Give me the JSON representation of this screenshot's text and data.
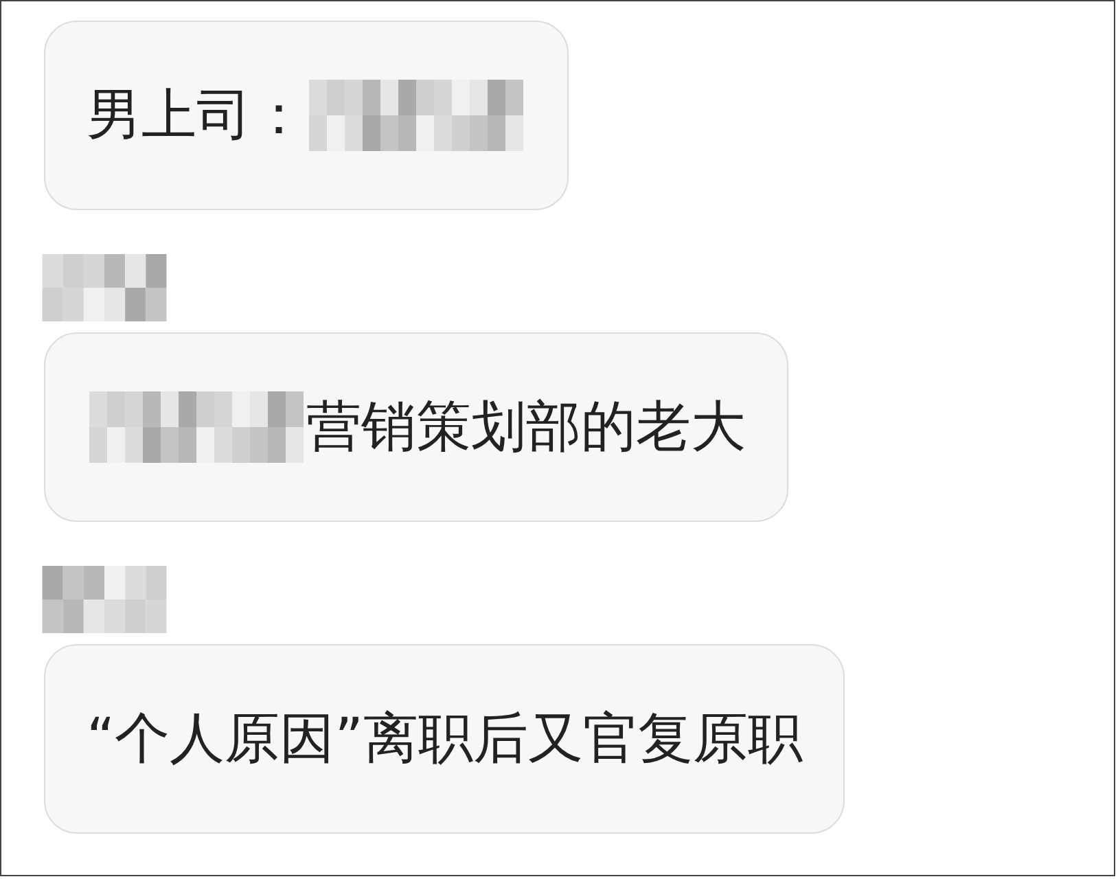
{
  "messages": [
    {
      "sender_redacted": false,
      "parts": [
        {
          "kind": "text",
          "text": "男上司："
        },
        {
          "kind": "redacted"
        }
      ]
    },
    {
      "sender_redacted": true,
      "parts": [
        {
          "kind": "redacted"
        },
        {
          "kind": "text",
          "text": "营销策划部的老大"
        }
      ]
    },
    {
      "sender_redacted": true,
      "parts": [
        {
          "kind": "text",
          "text": "“个人原因”离职后又官复原职"
        }
      ]
    }
  ]
}
